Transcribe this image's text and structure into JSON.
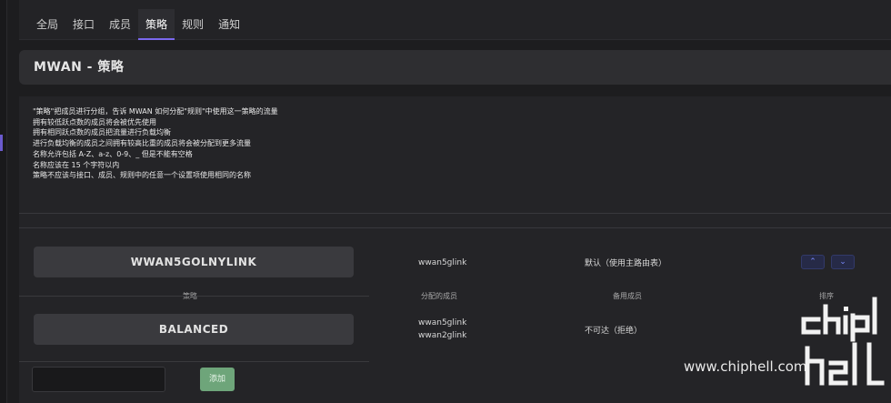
{
  "tabs": [
    {
      "label": "全局"
    },
    {
      "label": "接口"
    },
    {
      "label": "成员"
    },
    {
      "label": "策略"
    },
    {
      "label": "规则"
    },
    {
      "label": "通知"
    }
  ],
  "active_tab": "策略",
  "page_title": "MWAN - 策略",
  "description": [
    "\"策略\"把成员进行分组，告诉 MWAN 如何分配\"规则\"中使用这一策略的流量",
    "拥有较低跃点数的成员将会被优先使用",
    "拥有相同跃点数的成员把流量进行负载均衡",
    "进行负载均衡的成员之间拥有较高比重的成员将会被分配到更多流量",
    "名称允许包括 A-Z、a-z、0-9、_ 但是不能有空格",
    "名称应该在 15 个字符以内",
    "策略不应该与接口、成员、规则中的任意一个设置项使用相同的名称"
  ],
  "table": {
    "headers": {
      "policy": "策略",
      "members": "分配的成员",
      "backup": "备用成员",
      "sort": "排序"
    },
    "rows": [
      {
        "policy": "WWAN5GOLNYLINK",
        "members": [
          "wwan5glink"
        ],
        "backup": "默认（使用主路由表）"
      },
      {
        "policy": "BALANCED",
        "members": [
          "wwan5glink",
          "wwan2glink"
        ],
        "backup": "不可达（拒绝）"
      }
    ]
  },
  "sort_buttons": {
    "up": "⌃",
    "down": "⌄"
  },
  "add": {
    "input_value": "",
    "button_label": "添加"
  },
  "watermark": "www.chiphell.com",
  "colors": {
    "accent": "#7b68ee",
    "add_button": "#6ea57a",
    "sort_button": "#262a47"
  }
}
